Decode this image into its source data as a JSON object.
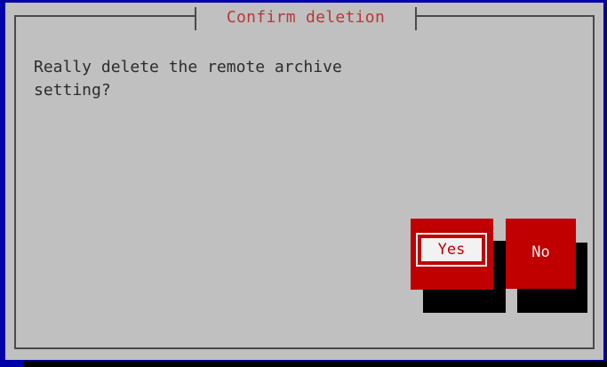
{
  "dialog": {
    "title": "Confirm deletion",
    "message": "Really delete the remote archive\nsetting?",
    "buttons": {
      "yes_label": "Yes",
      "no_label": "No"
    }
  },
  "colors": {
    "screen_background": "#0000a8",
    "dialog_background": "#c0c0c0",
    "title_text": "#b83838",
    "button_background": "#c00000",
    "focused_button_label_background": "#f2f2f2"
  }
}
